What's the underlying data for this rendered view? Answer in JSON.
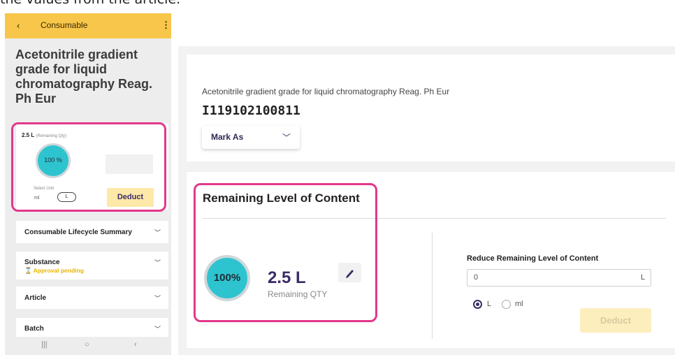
{
  "caption": "the values from the article.",
  "mobile": {
    "header_title": "Consumable",
    "back_glyph": "‹",
    "menu_glyph": "⋮",
    "product_name": "Acetonitrile gradient grade for liquid chromatography Reag. Ph Eur",
    "qty_value": "2.5 L",
    "qty_caption": "(Remaining Qty)",
    "percent": "100 %",
    "select_unit_label": "Select Unit",
    "unit_ml": "ml",
    "unit_L": "L",
    "deduct_label": "Deduct",
    "accordions": [
      {
        "label": "Consumable Lifecycle Summary",
        "sub": ""
      },
      {
        "label": "Substance",
        "sub": "⌛ Approval pending"
      },
      {
        "label": "Article",
        "sub": ""
      },
      {
        "label": "Batch",
        "sub": ""
      }
    ],
    "nav": {
      "recents": "|||",
      "home": "○",
      "back": "‹"
    }
  },
  "desktop": {
    "product_name": "Acetonitrile gradient grade for liquid chromatography Reag. Ph Eur",
    "product_id": "I119102100811",
    "mark_as_label": "Mark As",
    "section_title": "Remaining Level of Content",
    "percent": "100%",
    "qty_value": "2.5 L",
    "qty_label": "Remaining QTY",
    "reduce_label": "Reduce Remaining Level of Content",
    "reduce_value": "0",
    "reduce_unit": "L",
    "radio_L": "L",
    "radio_ml": "ml",
    "deduct_label": "Deduct"
  },
  "colors": {
    "header_yellow": "#f7c64a",
    "accent_teal": "#2ec4cf",
    "accent_purple": "#3b2b66",
    "highlight_magenta": "#e2388b",
    "pending_yellow": "#e8b400"
  }
}
